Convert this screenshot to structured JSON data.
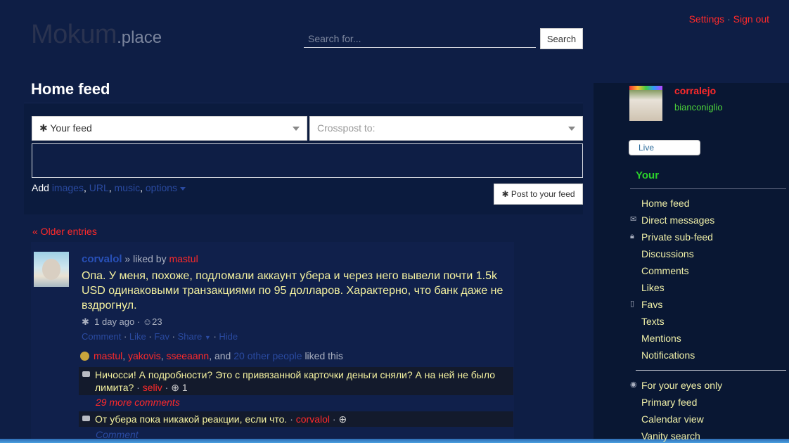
{
  "header": {
    "logo_main": "Mokum",
    "logo_suffix": ".place",
    "search_placeholder": "Search for...",
    "search_button": "Search",
    "settings_link": "Settings",
    "link_separator": "·",
    "signout_link": "Sign out"
  },
  "main": {
    "page_title": "Home feed",
    "composer": {
      "feed_select_value": "✱ Your feed",
      "crosspost_placeholder": "Crosspost to:",
      "add_label": "Add",
      "add_images": "images",
      "add_url": "URL",
      "add_music": "music",
      "add_options": "options",
      "post_button": "✱ Post to your feed"
    },
    "older_entries": "« Older entries",
    "entry": {
      "author": "corvalol",
      "liked_by_label": "» liked by",
      "liked_by_user": "mastul",
      "text": "Опа. У меня, похоже, подломали аккаунт убера и через него вывели почти 1.5k USD одинаковыми транзакциями по 95 долларов. Характерно, что банк даже не вздрогнул.",
      "time": "1 day ago",
      "reactions_count": "23",
      "actions": [
        "Comment",
        "Like",
        "Fav",
        "Share",
        "Hide"
      ],
      "likers": [
        "mastul",
        "yakovis",
        "sseeaann"
      ],
      "likers_and": ", and",
      "other_people": "20 other people",
      "liked_this": "liked this",
      "comments": [
        {
          "text": "Ничосси! А подробности? Это с привязанной карточки деньги сняли? А на ней не было лимита?",
          "user": "seliv",
          "votes": "1"
        },
        {
          "text": "От убера пока никакой реакции, если что.",
          "user": "corvalol",
          "votes": ""
        }
      ],
      "more_comments": "29 more comments",
      "add_comment": "Comment"
    }
  },
  "sidebar": {
    "username": "corralejo",
    "subname": "bianconiglio",
    "live_label": "Live",
    "section_title": "Your",
    "nav_items": [
      {
        "label": "Home feed",
        "icon": ""
      },
      {
        "label": "Direct messages",
        "icon": "envelope-icon"
      },
      {
        "label": "Private sub-feed",
        "icon": "lock-icon"
      },
      {
        "label": "Discussions",
        "icon": ""
      },
      {
        "label": "Comments",
        "icon": ""
      },
      {
        "label": "Likes",
        "icon": ""
      },
      {
        "label": "Favs",
        "icon": "bookmark-icon"
      },
      {
        "label": "Texts",
        "icon": ""
      },
      {
        "label": "Mentions",
        "icon": ""
      },
      {
        "label": "Notifications",
        "icon": ""
      }
    ],
    "nav_items_2": [
      {
        "label": "For your eyes only",
        "icon": "eye-icon"
      },
      {
        "label": "Primary feed",
        "icon": ""
      },
      {
        "label": "Calendar view",
        "icon": ""
      },
      {
        "label": "Vanity search",
        "icon": ""
      }
    ]
  },
  "colors": {
    "background": "#0e1e45",
    "sidebar": "#091733",
    "link_red": "#ff2a2a",
    "link_blue": "#2a4aa0",
    "text_yellow": "#f5f2a0",
    "accent_green": "#2bd12b"
  }
}
